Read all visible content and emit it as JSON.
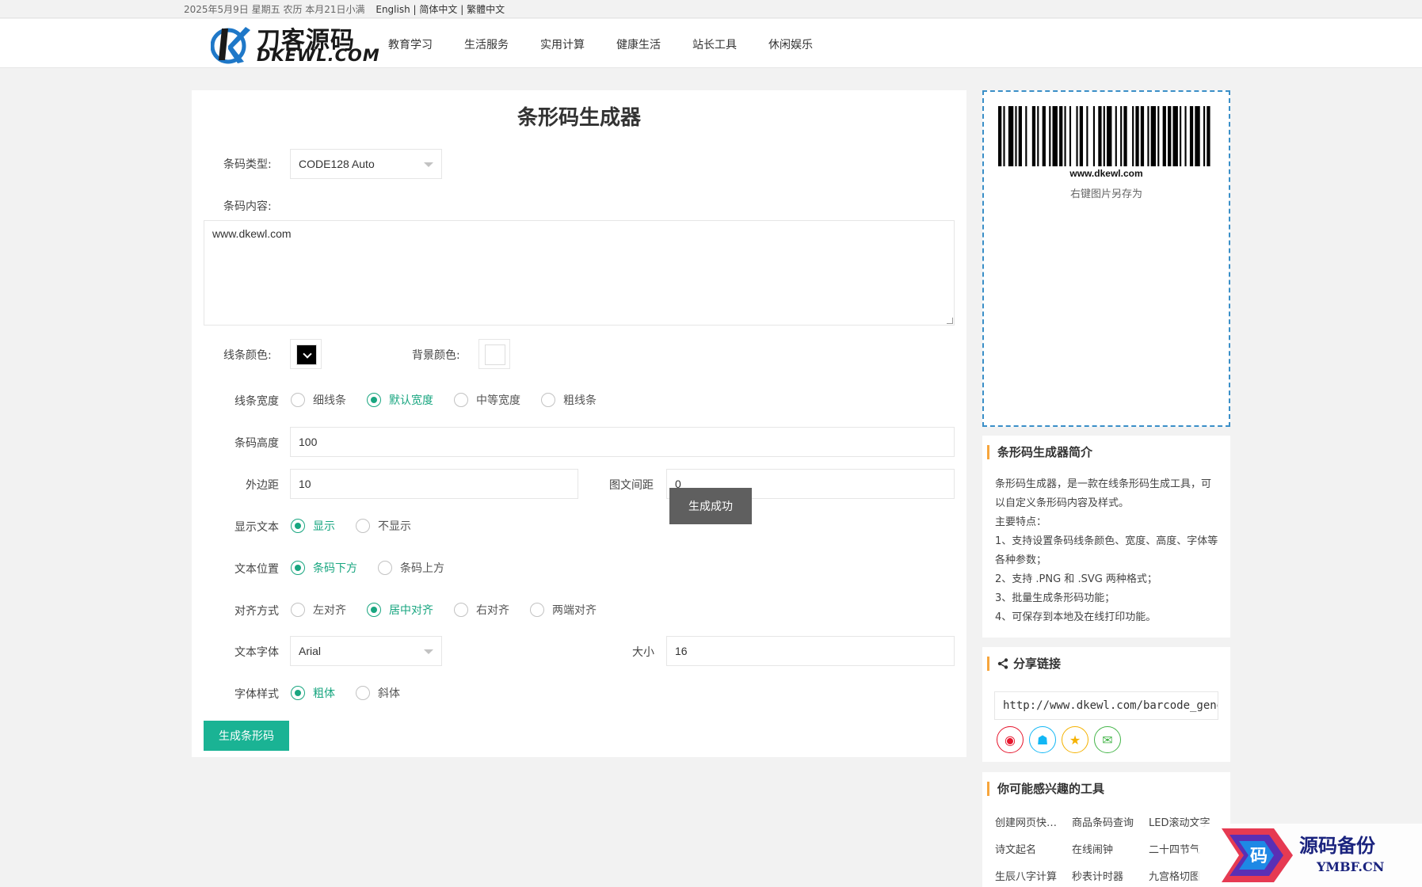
{
  "topbar": {
    "date": "2025年5月9日 星期五 农历 本月21日小满",
    "lang_en": "English",
    "lang_sc": "简体中文",
    "lang_tc": "繁體中文",
    "sep": "|"
  },
  "logo": {
    "cn": "刀客源码",
    "en": "DKEWL.COM"
  },
  "nav": [
    "教育学习",
    "生活服务",
    "实用计算",
    "健康生活",
    "站长工具",
    "休闲娱乐"
  ],
  "form": {
    "title": "条形码生成器",
    "type_label": "条码类型:",
    "type_value": "CODE128 Auto",
    "content_label": "条码内容:",
    "content_value": "www.dkewl.com",
    "line_color_label": "线条颜色:",
    "bg_color_label": "背景颜色:",
    "width_label": "线条宽度",
    "width_options": [
      "细线条",
      "默认宽度",
      "中等宽度",
      "粗线条"
    ],
    "height_label": "条码高度",
    "height_value": "100",
    "margin_label": "外边距",
    "margin_value": "10",
    "textmargin_label": "图文间距",
    "textmargin_value": "0",
    "show_text_label": "显示文本",
    "show_text_options": [
      "显示",
      "不显示"
    ],
    "text_pos_label": "文本位置",
    "text_pos_options": [
      "条码下方",
      "条码上方"
    ],
    "align_label": "对齐方式",
    "align_options": [
      "左对齐",
      "居中对齐",
      "右对齐",
      "两端对齐"
    ],
    "font_label": "文本字体",
    "font_value": "Arial",
    "size_label": "大小",
    "size_value": "16",
    "style_label": "字体样式",
    "style_options": [
      "粗体",
      "斜体"
    ],
    "generate_button": "生成条形码",
    "toast": "生成成功"
  },
  "preview": {
    "barcode_text": "www.dkewl.com",
    "hint": "右键图片另存为"
  },
  "intro": {
    "title": "条形码生成器简介",
    "lines": [
      "条形码生成器，是一款在线条形码生成工具，可以自定义条形码内容及样式。",
      "主要特点：",
      "1、支持设置条码线条颜色、宽度、高度、字体等各种参数；",
      "2、支持 .PNG 和 .SVG 两种格式；",
      "3、批量生成条形码功能；",
      "4、可保存到本地及在线打印功能。"
    ]
  },
  "share": {
    "title": "分享链接",
    "url": "http://www.dkewl.com/barcode_generati"
  },
  "tools": {
    "title": "你可能感兴趣的工具",
    "items": [
      "创建网页快捷方式",
      "商品条码查询",
      "LED滚动文字",
      "诗文起名",
      "在线闹钟",
      "二十四节气",
      "生辰八字计算",
      "秒表计时器",
      "九宫格切图"
    ]
  },
  "watermark": {
    "cn": "源码备份",
    "en": "YMBF.CN",
    "glyph": "码"
  },
  "colors": {
    "accent": "#19a680",
    "button": "#1ab394",
    "preview_border": "#3a8fc8",
    "title_bar": "#f7a53c"
  }
}
